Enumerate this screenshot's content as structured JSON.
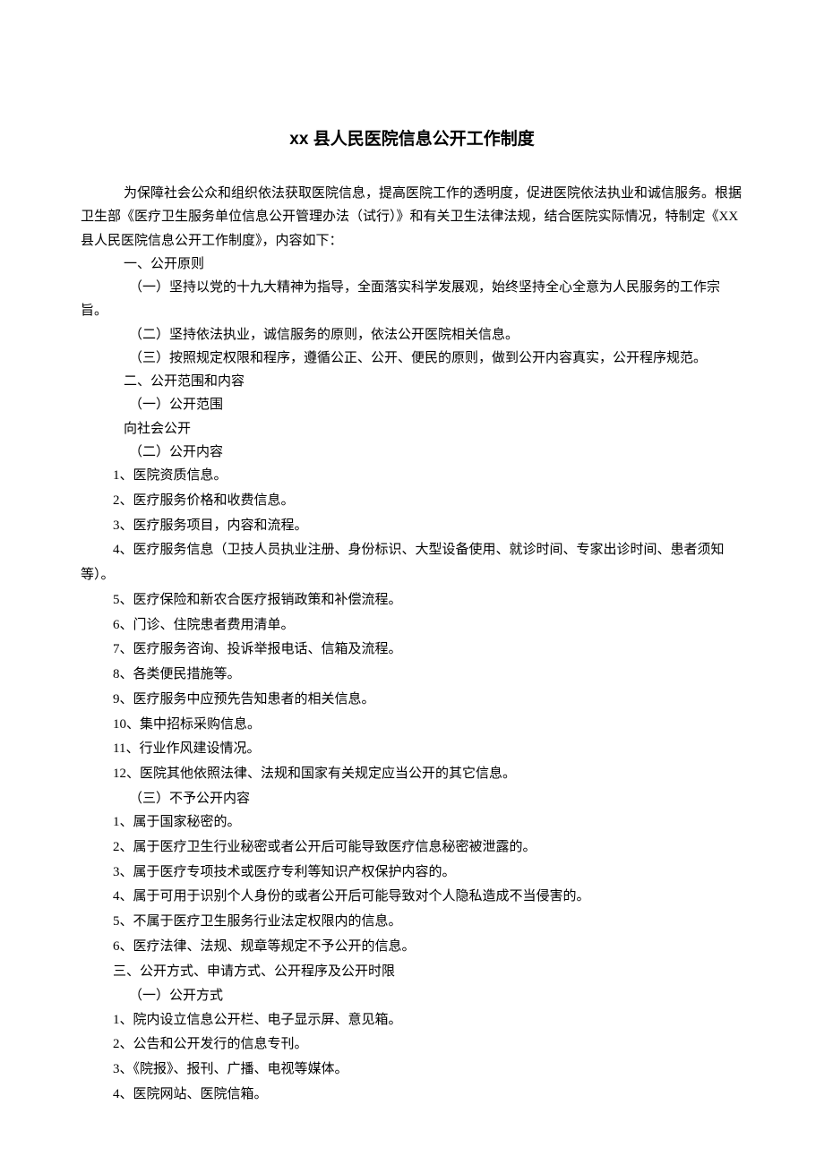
{
  "title": "xx 县人民医院信息公开工作制度",
  "intro": "为保障社会公众和组织依法获取医院信息，提高医院工作的透明度，促进医院依法执业和诚信服务。根据卫生部《医疗卫生服务单位信息公开管理办法（试行）》和有关卫生法律法规，结合医院实际情况，特制定《XX 县人民医院信息公开工作制度》，内容如下：",
  "s1": {
    "head": "一、公开原则",
    "p1": "（一）坚持以党的十九大精神为指导，全面落实科学发展观，始终坚持全心全意为人民服务的工作宗旨。",
    "p2": "（二）坚持依法执业，诚信服务的原则，依法公开医院相关信息。",
    "p3": "（三）按照规定权限和程序，遵循公正、公开、便民的原则，做到公开内容真实，公开程序规范。"
  },
  "s2": {
    "head": "二、公开范围和内容",
    "sub1": "（一）公开范围",
    "scope": "向社会公开",
    "sub2": "（二）公开内容",
    "i1": "1、医院资质信息。",
    "i2": "2、医疗服务价格和收费信息。",
    "i3": "3、医疗服务项目，内容和流程。",
    "i4": "4、医疗服务信息（卫技人员执业注册、身份标识、大型设备使用、就诊时间、专家出诊时间、患者须知等）。",
    "i5": "5、医疗保险和新农合医疗报销政策和补偿流程。",
    "i6": "6、门诊、住院患者费用清单。",
    "i7": "7、医疗服务咨询、投诉举报电话、信箱及流程。",
    "i8": "8、各类便民措施等。",
    "i9": "9、医疗服务中应预先告知患者的相关信息。",
    "i10": "10、集中招标采购信息。",
    "i11": "11、行业作风建设情况。",
    "i12": "12、医院其他依照法律、法规和国家有关规定应当公开的其它信息。",
    "sub3": "（三）不予公开内容",
    "n1": "1、属于国家秘密的。",
    "n2": "2、属于医疗卫生行业秘密或者公开后可能导致医疗信息秘密被泄露的。",
    "n3": "3、属于医疗专项技术或医疗专利等知识产权保护内容的。",
    "n4": "4、属于可用于识别个人身份的或者公开后可能导致对个人隐私造成不当侵害的。",
    "n5": "5、不属于医疗卫生服务行业法定权限内的信息。",
    "n6": "6、医疗法律、法规、规章等规定不予公开的信息。"
  },
  "s3": {
    "head": "三、公开方式、申请方式、公开程序及公开时限",
    "sub1": "（一）公开方式",
    "m1": "1、院内设立信息公开栏、电子显示屏、意见箱。",
    "m2": "2、公告和公开发行的信息专刊。",
    "m3": "3、《院报》、报刊、广播、电视等媒体。",
    "m4": "4、医院网站、医院信箱。"
  }
}
